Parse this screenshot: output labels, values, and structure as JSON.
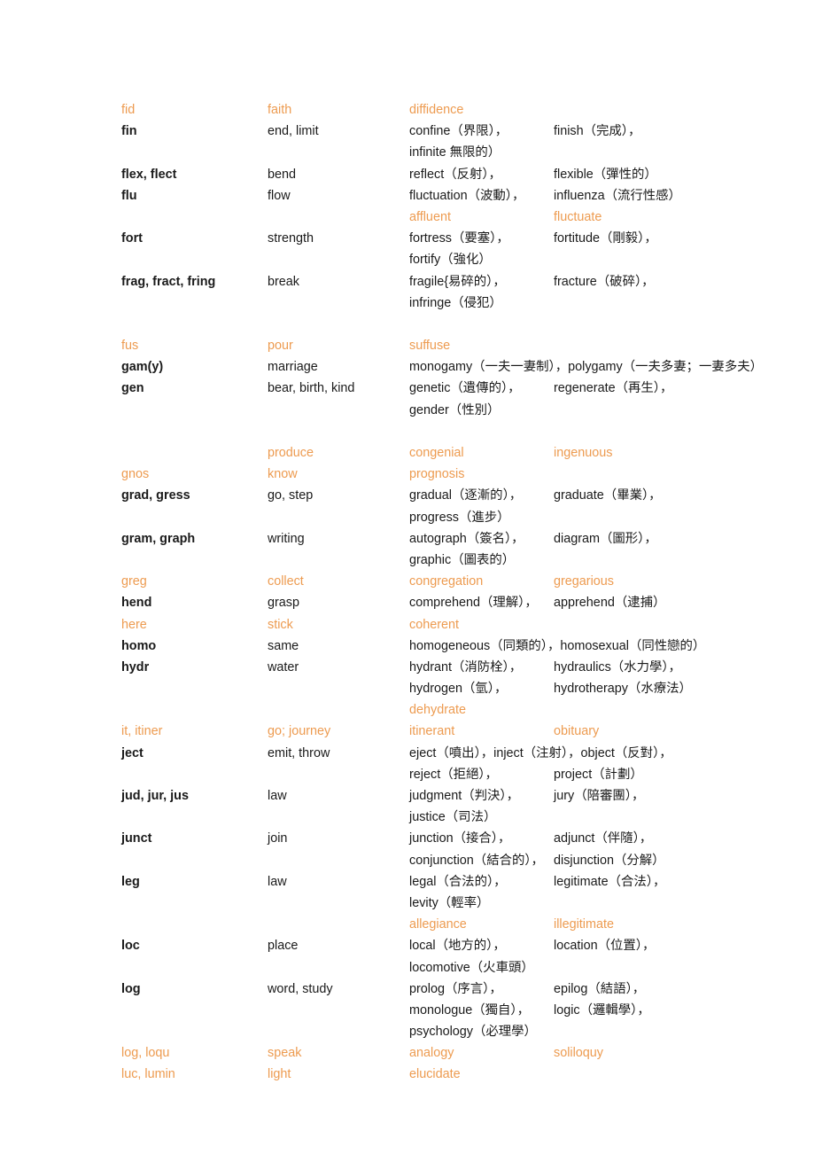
{
  "document": {
    "title": "English Root Words Reference Table",
    "colors": {
      "highlight": "#ED9B50",
      "text": "#1A1A1A",
      "background": "#FFFFFF"
    },
    "columns": [
      "root",
      "meaning",
      "examples_1",
      "examples_2"
    ]
  },
  "rows": [
    {
      "style": "orange",
      "c1": "fid",
      "c2": "faith",
      "c3": "diffidence",
      "c4": ""
    },
    {
      "style": "normal",
      "c1": "fin",
      "c2": "end, limit",
      "c3": "confine（界限），",
      "c4": "finish（完成），"
    },
    {
      "style": "normal",
      "c1": "",
      "c2": "",
      "c3": "infinite 無限的）",
      "c4": ""
    },
    {
      "style": "normal",
      "c1": "flex, flect",
      "c2": "bend",
      "c3": "reflect（反射），",
      "c4": "flexible（彈性的）"
    },
    {
      "style": "normal",
      "c1": "flu",
      "c2": "flow",
      "c3": "fluctuation（波動），",
      "c4": "influenza（流行性感）"
    },
    {
      "style": "orange",
      "c1": "",
      "c2": "",
      "c3": "affluent",
      "c4": "fluctuate"
    },
    {
      "style": "normal",
      "c1": "fort",
      "c2": "strength",
      "c3": "fortress（要塞），",
      "c4": "fortitude（剛毅），"
    },
    {
      "style": "normal",
      "c1": "",
      "c2": "",
      "c3": "fortify（強化）",
      "c4": ""
    },
    {
      "style": "normal",
      "c1": "frag, fract, fring",
      "c2": "break",
      "c3": "fragile{易碎的），",
      "c4": "fracture（破碎），"
    },
    {
      "style": "normal",
      "c1": "",
      "c2": "",
      "c3": "infringe（侵犯）",
      "c4": ""
    },
    {
      "style": "spacer",
      "c1": "",
      "c2": "",
      "c3": "",
      "c4": ""
    },
    {
      "style": "orange",
      "c1": "fus",
      "c2": "pour",
      "c3": "suffuse",
      "c4": ""
    },
    {
      "style": "normal",
      "c1": "gam(y)",
      "c2": "marriage",
      "c3": "monogamy（一夫一妻制），polygamy（一夫多妻；一妻多夫）",
      "c4": "",
      "wide": true
    },
    {
      "style": "normal",
      "c1": "gen",
      "c2": "bear, birth, kind",
      "c3": "genetic（遺傳的），",
      "c4": "regenerate（再生），"
    },
    {
      "style": "normal",
      "c1": "",
      "c2": "",
      "c3": "gender（性別）",
      "c4": ""
    },
    {
      "style": "spacer",
      "c1": "",
      "c2": "",
      "c3": "",
      "c4": ""
    },
    {
      "style": "orange",
      "c1": "",
      "c2": "produce",
      "c3": "congenial",
      "c4": "ingenuous"
    },
    {
      "style": "orange",
      "c1": "gnos",
      "c2": "know",
      "c3": "prognosis",
      "c4": ""
    },
    {
      "style": "normal",
      "c1": "grad, gress",
      "c2": "go, step",
      "c3": "gradual（逐漸的），",
      "c4": "graduate（畢業），"
    },
    {
      "style": "normal",
      "c1": "",
      "c2": "",
      "c3": "progress（進步）",
      "c4": ""
    },
    {
      "style": "normal",
      "c1": "gram, graph",
      "c2": "writing",
      "c3": "autograph（簽名），",
      "c4": "diagram（圖形），"
    },
    {
      "style": "normal",
      "c1": "",
      "c2": "",
      "c3": "graphic（圖表的）",
      "c4": ""
    },
    {
      "style": "orange",
      "c1": "greg",
      "c2": "collect",
      "c3": "congregation",
      "c4": "gregarious"
    },
    {
      "style": "normal",
      "c1": "hend",
      "c2": "grasp",
      "c3": "comprehend（理解），",
      "c4": "apprehend（逮捕）"
    },
    {
      "style": "orange",
      "c1": "here",
      "c2": "stick",
      "c3": "coherent",
      "c4": ""
    },
    {
      "style": "normal",
      "c1": "homo",
      "c2": "same",
      "c3": "homogeneous（同類的），homosexual（同性戀的）",
      "c4": "",
      "wide": true
    },
    {
      "style": "normal",
      "c1": "hydr",
      "c2": "water",
      "c3": "hydrant（消防栓），",
      "c4": "hydraulics（水力學），"
    },
    {
      "style": "normal",
      "c1": "",
      "c2": "",
      "c3": "hydrogen（氫），",
      "c4": "hydrotherapy（水療法）"
    },
    {
      "style": "orange",
      "c1": "",
      "c2": "",
      "c3": "dehydrate",
      "c4": ""
    },
    {
      "style": "orange",
      "c1": "it, itiner",
      "c2": "go; journey",
      "c3": "itinerant",
      "c4": "obituary"
    },
    {
      "style": "normal",
      "c1": "ject",
      "c2": "emit, throw",
      "c3": "eject（噴出），inject（注射），object（反對），",
      "c4": "",
      "wide": true
    },
    {
      "style": "normal",
      "c1": "",
      "c2": "",
      "c3": "reject（拒絕），",
      "c4": "project（計劃）"
    },
    {
      "style": "normal",
      "c1": "jud, jur, jus",
      "c2": "law",
      "c3": "judgment（判決），",
      "c4": "jury（陪審團），"
    },
    {
      "style": "normal",
      "c1": "",
      "c2": "",
      "c3": "justice（司法）",
      "c4": ""
    },
    {
      "style": "normal",
      "c1": "junct",
      "c2": "join",
      "c3": "junction（接合），",
      "c4": "adjunct（伴隨），"
    },
    {
      "style": "normal",
      "c1": "",
      "c2": "",
      "c3": "conjunction（結合的），",
      "c4": "disjunction（分解）"
    },
    {
      "style": "normal",
      "c1": "leg",
      "c2": "law",
      "c3": "legal（合法的），",
      "c4": "legitimate（合法），"
    },
    {
      "style": "normal",
      "c1": "",
      "c2": "",
      "c3": "levity（輕率）",
      "c4": ""
    },
    {
      "style": "orange",
      "c1": "",
      "c2": "",
      "c3": "allegiance",
      "c4": "illegitimate"
    },
    {
      "style": "normal",
      "c1": "loc",
      "c2": "place",
      "c3": "local（地方的），",
      "c4": "location（位置），"
    },
    {
      "style": "normal",
      "c1": "",
      "c2": "",
      "c3": "locomotive（火車頭）",
      "c4": ""
    },
    {
      "style": "normal",
      "c1": "log",
      "c2": "word, study",
      "c3": "prolog（序言），",
      "c4": "epilog（結語），"
    },
    {
      "style": "normal",
      "c1": "",
      "c2": "",
      "c3": "monologue（獨自），",
      "c4": "logic（邏輯學），"
    },
    {
      "style": "normal",
      "c1": "",
      "c2": "",
      "c3": "psychology（必理學）",
      "c4": ""
    },
    {
      "style": "orange",
      "c1": "log, loqu",
      "c2": "speak",
      "c3": "analogy",
      "c4": "soliloquy"
    },
    {
      "style": "orange",
      "c1": "luc, lumin",
      "c2": "light",
      "c3": "elucidate",
      "c4": ""
    }
  ]
}
